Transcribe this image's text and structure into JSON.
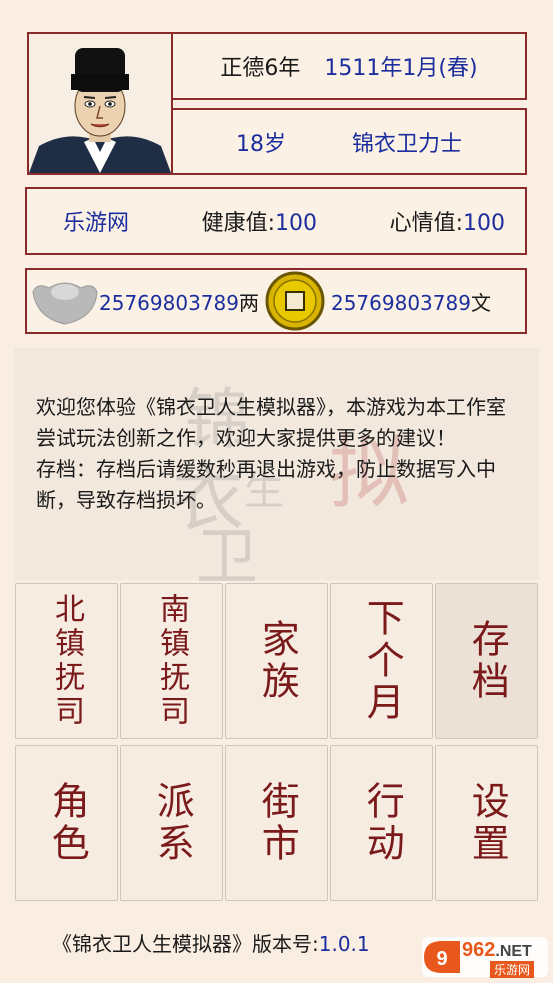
{
  "header": {
    "era": "正德6年",
    "date_year": "1511年1月",
    "season": "(春)",
    "age": "18岁",
    "role": "锦衣卫力士"
  },
  "stats": {
    "name": "乐游网",
    "health_label": "健康值:",
    "health_value": "100",
    "mood_label": "心情值:",
    "mood_value": "100"
  },
  "money": {
    "silver_amount": "25769803789",
    "silver_unit": "两",
    "copper_amount": "25769803789",
    "copper_unit": "文"
  },
  "message": {
    "line1": "欢迎您体验《锦衣卫人生模拟器》，本游戏为本工作室尝试玩法创新之作，欢迎大家提供更多的建议！",
    "line2": "存档：存档后请缓数秒再退出游戏，防止数据写入中断，导致存档损坏。"
  },
  "buttons": {
    "north": "北镇抚司",
    "south": "南镇抚司",
    "family": "家族",
    "next_month": "下个月",
    "save": "存档",
    "character": "角色",
    "faction": "派系",
    "market": "街市",
    "action": "行动",
    "settings": "设置"
  },
  "footer": {
    "title": "《锦衣卫人生模拟器》版本号:",
    "version": "1.0.1"
  },
  "watermark": {
    "logo_text": "962",
    "logo_suffix": ".NET",
    "logo_sub": "乐游网"
  }
}
